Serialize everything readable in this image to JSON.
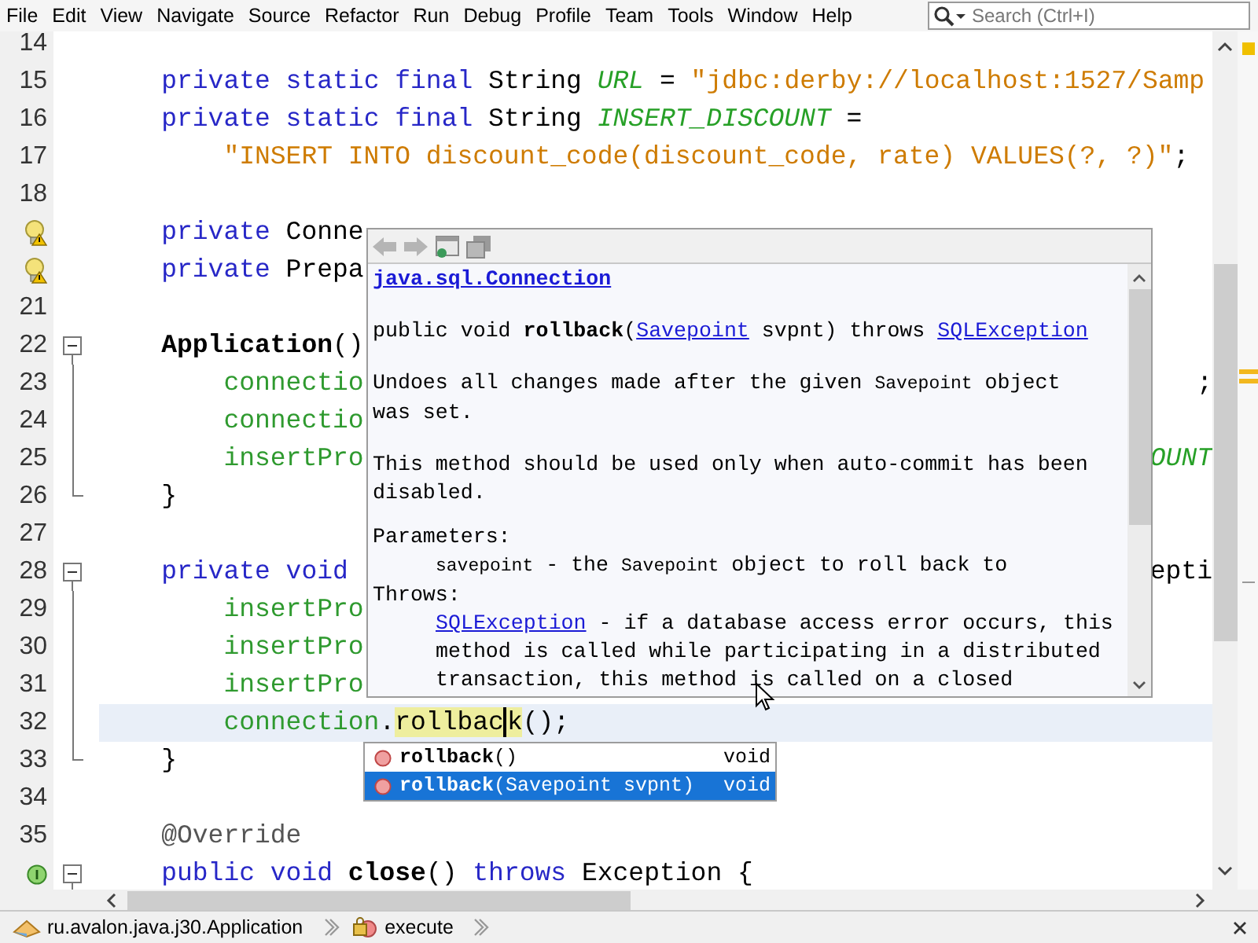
{
  "menu": [
    "File",
    "Edit",
    "View",
    "Navigate",
    "Source",
    "Refactor",
    "Run",
    "Debug",
    "Profile",
    "Team",
    "Tools",
    "Window",
    "Help"
  ],
  "search": {
    "placeholder": "Search (Ctrl+I)"
  },
  "editor": {
    "lines": [
      {
        "number": "14"
      },
      {
        "number": "15",
        "indent": {
          "kind": "single"
        },
        "tokens": [
          {
            "text": "private static final",
            "kind": "keyword"
          },
          {
            "text": " String ",
            "kind": "plain"
          },
          {
            "text": "URL",
            "kind": "constant"
          },
          {
            "text": " = ",
            "kind": "plain"
          },
          {
            "text": "\"jdbc:derby://localhost:1527/Samp",
            "kind": "string"
          }
        ]
      },
      {
        "number": "16",
        "indent": {
          "kind": "single"
        },
        "tokens": [
          {
            "text": "private static final",
            "kind": "keyword"
          },
          {
            "text": " String ",
            "kind": "plain"
          },
          {
            "text": "INSERT_DISCOUNT",
            "kind": "constant"
          },
          {
            "text": " =",
            "kind": "plain"
          }
        ]
      },
      {
        "number": "17",
        "indent": {
          "kind": "double"
        },
        "tokens": [
          {
            "text": "\"INSERT INTO discount_code(discount_code, rate) VALUES(?, ?)\"",
            "kind": "string"
          },
          {
            "text": ";",
            "kind": "plain"
          }
        ]
      },
      {
        "number": "18"
      },
      {
        "marker": {
          "kind": "warning"
        },
        "indent": {
          "kind": "single"
        },
        "tokens": [
          {
            "text": "private",
            "kind": "keyword"
          },
          {
            "text": " Conne",
            "kind": "plain"
          }
        ]
      },
      {
        "marker": {
          "kind": "warning"
        },
        "indent": {
          "kind": "single"
        },
        "tokens": [
          {
            "text": "private",
            "kind": "keyword"
          },
          {
            "text": " Prepa",
            "kind": "plain"
          }
        ]
      },
      {
        "number": "21"
      },
      {
        "number": "22",
        "fold": {
          "kind": "start"
        },
        "indent": {
          "kind": "single"
        },
        "tokens": [
          {
            "text": "Application",
            "kind": "bold"
          },
          {
            "text": "()",
            "kind": "plain"
          }
        ]
      },
      {
        "number": "23",
        "fold": {
          "kind": "line"
        },
        "indent": {
          "kind": "double"
        },
        "tokens": [
          {
            "text": "connectio",
            "kind": "field"
          }
        ],
        "tail": [
          {
            "text": ";",
            "kind": "plain"
          }
        ]
      },
      {
        "number": "24",
        "fold": {
          "kind": "line"
        },
        "indent": {
          "kind": "double"
        },
        "tokens": [
          {
            "text": "connectio",
            "kind": "field"
          }
        ]
      },
      {
        "number": "25",
        "fold": {
          "kind": "line"
        },
        "indent": {
          "kind": "double"
        },
        "tokens": [
          {
            "text": "insertPro",
            "kind": "field"
          }
        ],
        "tail": [
          {
            "text": "OUNT",
            "kind": "constant"
          }
        ]
      },
      {
        "number": "26",
        "fold": {
          "kind": "end"
        },
        "indent": {
          "kind": "single"
        },
        "tokens": [
          {
            "text": "}",
            "kind": "plain"
          }
        ]
      },
      {
        "number": "27"
      },
      {
        "number": "28",
        "fold": {
          "kind": "start"
        },
        "indent": {
          "kind": "single"
        },
        "tokens": [
          {
            "text": "private void",
            "kind": "keyword"
          }
        ],
        "tail": [
          {
            "text": "epti",
            "kind": "plain"
          }
        ]
      },
      {
        "number": "29",
        "fold": {
          "kind": "line"
        },
        "indent": {
          "kind": "double"
        },
        "tokens": [
          {
            "text": "insertPro",
            "kind": "field"
          }
        ]
      },
      {
        "number": "30",
        "fold": {
          "kind": "line"
        },
        "indent": {
          "kind": "double"
        },
        "tokens": [
          {
            "text": "insertPro",
            "kind": "field"
          }
        ]
      },
      {
        "number": "31",
        "fold": {
          "kind": "line"
        },
        "indent": {
          "kind": "double"
        },
        "tokens": [
          {
            "text": "insertPro",
            "kind": "field"
          }
        ]
      },
      {
        "number": "32",
        "fold": {
          "kind": "line"
        },
        "current": true,
        "indent": {
          "kind": "double"
        },
        "tokens": [
          {
            "text": "connection",
            "kind": "field"
          },
          {
            "text": ".",
            "kind": "plain"
          },
          {
            "text": "rollbac",
            "kind": "plain",
            "highlight": true,
            "caret": true
          },
          {
            "text": "k",
            "kind": "plain",
            "highlight": true
          },
          {
            "text": "();",
            "kind": "plain"
          }
        ]
      },
      {
        "number": "33",
        "fold": {
          "kind": "end"
        },
        "indent": {
          "kind": "single"
        },
        "tokens": [
          {
            "text": "}",
            "kind": "plain"
          }
        ]
      },
      {
        "number": "34"
      },
      {
        "number": "35",
        "indent": {
          "kind": "single"
        },
        "tokens": [
          {
            "text": "@Override",
            "kind": "annotation"
          }
        ]
      },
      {
        "marker": {
          "kind": "implements"
        },
        "fold": {
          "kind": "start"
        },
        "indent": {
          "kind": "single"
        },
        "tokens": [
          {
            "text": "public void ",
            "kind": "keyword"
          },
          {
            "text": "close",
            "kind": "bold"
          },
          {
            "text": "() ",
            "kind": "plain"
          },
          {
            "text": "throws",
            "kind": "keyword"
          },
          {
            "text": " Exception {",
            "kind": "plain"
          }
        ]
      }
    ]
  },
  "javadoc": {
    "header": "java.sql.Connection",
    "blocks": [
      {
        "kind": "signature",
        "lines": [
          [
            {
              "text": "public void ",
              "kind": "plain"
            },
            {
              "text": "rollback",
              "kind": "bold"
            },
            {
              "text": "(",
              "kind": "plain"
            },
            {
              "text": "Savepoint",
              "kind": "link"
            },
            {
              "text": " svpnt) throws ",
              "kind": "plain"
            },
            {
              "text": "SQLException",
              "kind": "link"
            }
          ]
        ]
      },
      {
        "kind": "para",
        "lines": [
          [
            {
              "text": "Undoes all changes made after the given ",
              "kind": "plain"
            },
            {
              "text": "Savepoint",
              "kind": "code"
            },
            {
              "text": " object",
              "kind": "plain"
            }
          ],
          [
            {
              "text": "was set.",
              "kind": "plain"
            }
          ]
        ]
      },
      {
        "kind": "para",
        "lines": [
          [
            {
              "text": "This method should be used only when auto-commit has been",
              "kind": "plain"
            }
          ],
          [
            {
              "text": "disabled.",
              "kind": "plain"
            }
          ]
        ]
      },
      {
        "kind": "heading",
        "lines": [
          [
            {
              "text": "Parameters:",
              "kind": "plain"
            }
          ]
        ]
      },
      {
        "kind": "detail",
        "lines": [
          [
            {
              "text": "savepoint",
              "kind": "code"
            },
            {
              "text": " - the ",
              "kind": "plain"
            },
            {
              "text": "Savepoint",
              "kind": "code"
            },
            {
              "text": " object to roll back to",
              "kind": "plain"
            }
          ]
        ]
      },
      {
        "kind": "heading",
        "lines": [
          [
            {
              "text": "Throws:",
              "kind": "plain"
            }
          ]
        ]
      },
      {
        "kind": "detail",
        "lines": [
          [
            {
              "text": "SQLException",
              "kind": "link"
            },
            {
              "text": " - if a database access error occurs, this",
              "kind": "plain"
            }
          ],
          [
            {
              "text": "method is called while participating in a distributed",
              "kind": "plain"
            }
          ],
          [
            {
              "text": "transaction, this method is called on a closed",
              "kind": "plain"
            }
          ]
        ]
      }
    ]
  },
  "completion": {
    "items": [
      {
        "name": "rollback",
        "params": "()",
        "type": "void",
        "selected": false
      },
      {
        "name": "rollback",
        "params": "(Savepoint svpnt)",
        "type": "void",
        "selected": true
      }
    ]
  },
  "breadcrumb": [
    {
      "label": "ru.avalon.java.j30.Application",
      "kind": "class"
    },
    {
      "label": "execute",
      "kind": "method"
    }
  ]
}
